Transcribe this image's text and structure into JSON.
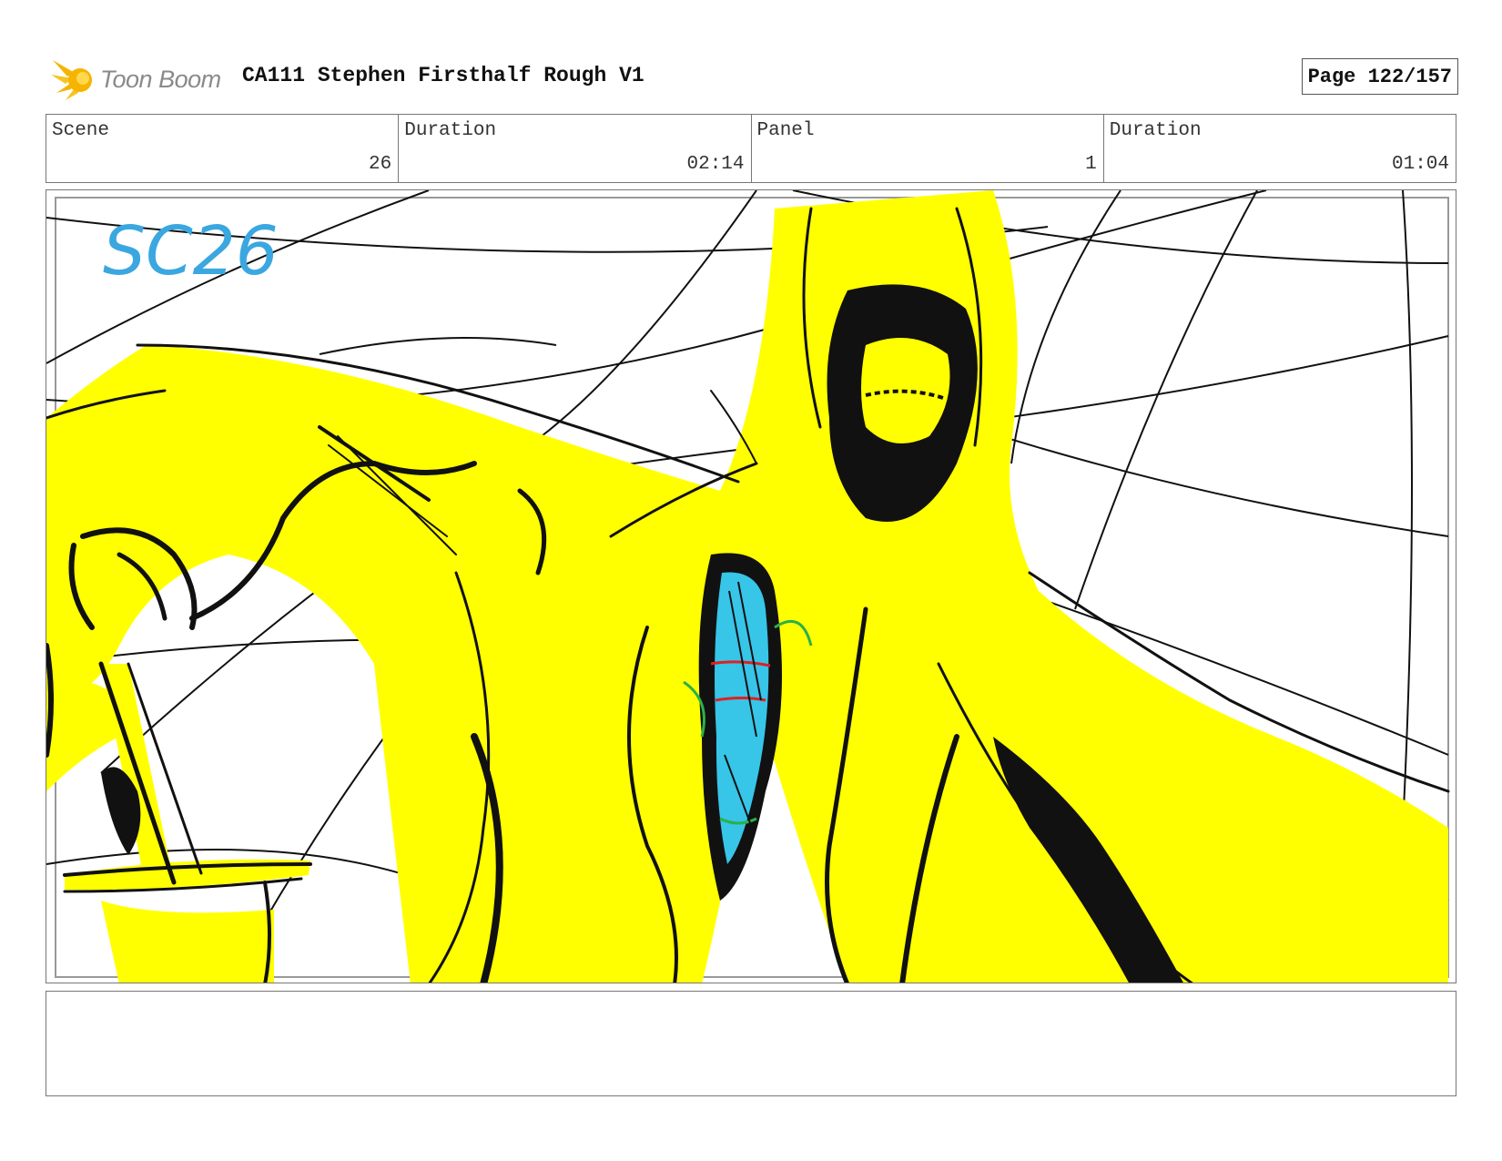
{
  "header": {
    "logo_text": "Toon Boom",
    "title": "CA111 Stephen Firsthalf Rough V1",
    "page_label": "Page 122/157"
  },
  "info": [
    {
      "label": "Scene",
      "value": "26"
    },
    {
      "label": "Duration",
      "value": "02:14"
    },
    {
      "label": "Panel",
      "value": "1"
    },
    {
      "label": "Duration",
      "value": "01:04"
    }
  ],
  "panel": {
    "handwritten_note": "SC26"
  },
  "caption": "",
  "colors": {
    "sketch_yellow": "#ffff00",
    "note_blue": "#3ba7e0",
    "line": "#111111",
    "logo_orange": "#f5b400"
  }
}
